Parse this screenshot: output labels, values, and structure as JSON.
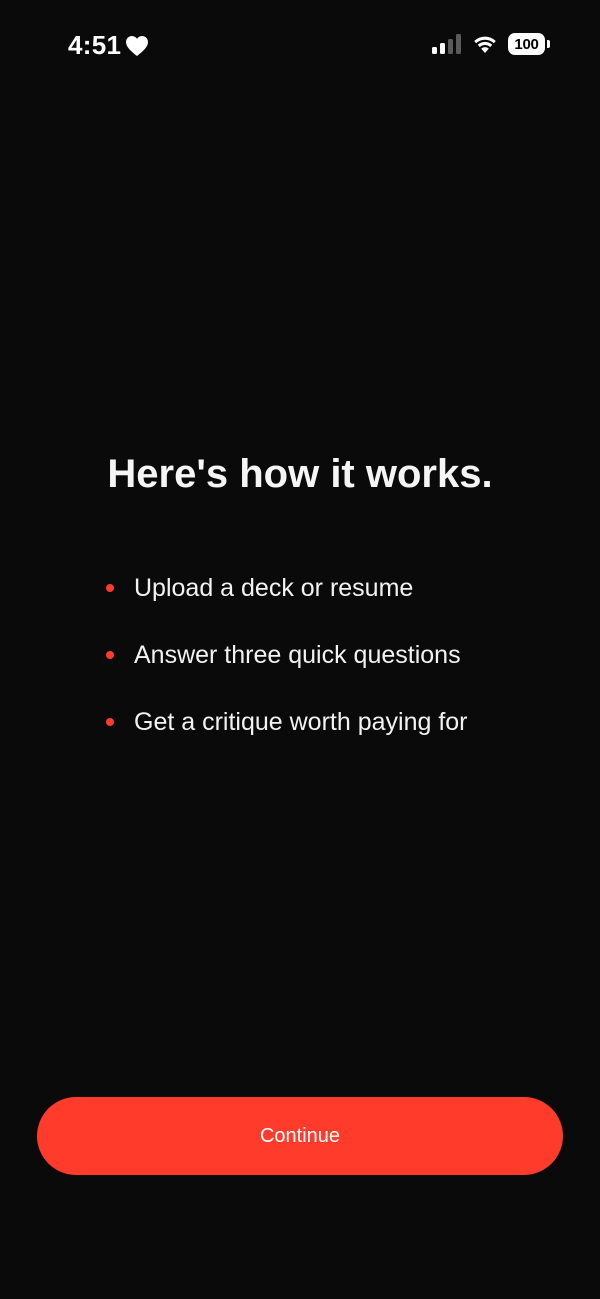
{
  "status_bar": {
    "time": "4:51",
    "heart_icon": "heart-icon",
    "signal_icon": "cellular-signal-icon",
    "wifi_icon": "wifi-icon",
    "battery_level": "100"
  },
  "main": {
    "headline": "Here's how it works.",
    "steps": [
      {
        "text": "Upload a deck or resume"
      },
      {
        "text": "Answer three quick questions"
      },
      {
        "text": "Get a critique worth paying for"
      }
    ]
  },
  "actions": {
    "continue_label": "Continue"
  },
  "colors": {
    "background": "#0a0a0a",
    "accent": "#ff3b2b",
    "text": "#ffffff"
  }
}
